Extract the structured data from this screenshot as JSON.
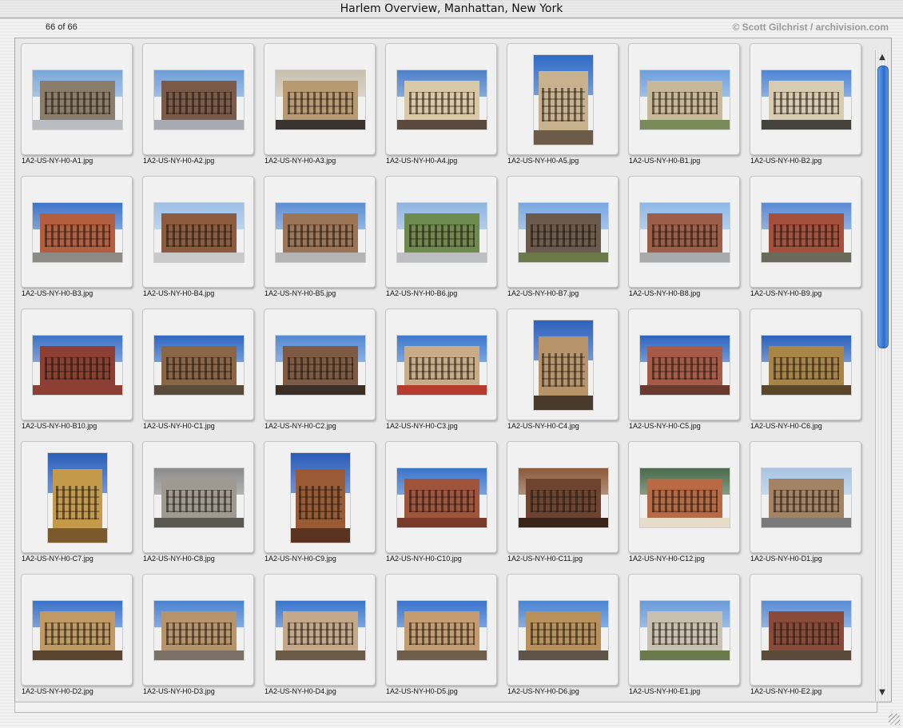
{
  "window": {
    "title": "Harlem Overview, Manhattan, New York"
  },
  "status": {
    "counter": "66 of 66",
    "copyright": "© Scott Gilchrist / archivision.com"
  },
  "thumbnails": [
    {
      "name": "1A2-US-NY-H0-A1.jpg",
      "orient": "land",
      "sky": "#7aa6d9",
      "bldg": "#8a7d6c",
      "ground": "#b9bcc0"
    },
    {
      "name": "1A2-US-NY-H0-A2.jpg",
      "orient": "land",
      "sky": "#6e9ed6",
      "bldg": "#7b5a4a",
      "ground": "#a7abb1"
    },
    {
      "name": "1A2-US-NY-H0-A3.jpg",
      "orient": "land",
      "sky": "#c8c0ae",
      "bldg": "#b89a72",
      "ground": "#3a3330"
    },
    {
      "name": "1A2-US-NY-H0-A4.jpg",
      "orient": "land",
      "sky": "#4d7fc7",
      "bldg": "#d9c9a6",
      "ground": "#5a4a3e"
    },
    {
      "name": "1A2-US-NY-H0-A5.jpg",
      "orient": "port",
      "sky": "#2f6bc6",
      "bldg": "#c8b18d",
      "ground": "#6c5b48"
    },
    {
      "name": "1A2-US-NY-H0-B1.jpg",
      "orient": "land",
      "sky": "#6d9fdc",
      "bldg": "#c8b89a",
      "ground": "#7a8a58"
    },
    {
      "name": "1A2-US-NY-H0-B2.jpg",
      "orient": "land",
      "sky": "#4f86d4",
      "bldg": "#d7cbb1",
      "ground": "#46423c"
    },
    {
      "name": "1A2-US-NY-H0-B3.jpg",
      "orient": "land",
      "sky": "#3f74c8",
      "bldg": "#b35e3e",
      "ground": "#8d8a86"
    },
    {
      "name": "1A2-US-NY-H0-B4.jpg",
      "orient": "land",
      "sky": "#9cc0e6",
      "bldg": "#8c5a3e",
      "ground": "#c9c9c9"
    },
    {
      "name": "1A2-US-NY-H0-B5.jpg",
      "orient": "land",
      "sky": "#5d8fd4",
      "bldg": "#9c7456",
      "ground": "#b4b4b4"
    },
    {
      "name": "1A2-US-NY-H0-B6.jpg",
      "orient": "land",
      "sky": "#8eb5e0",
      "bldg": "#6f8a4e",
      "ground": "#bdbfc3"
    },
    {
      "name": "1A2-US-NY-H0-B7.jpg",
      "orient": "land",
      "sky": "#78a7e0",
      "bldg": "#6b5a4e",
      "ground": "#6a7a4a"
    },
    {
      "name": "1A2-US-NY-H0-B8.jpg",
      "orient": "land",
      "sky": "#8db8e6",
      "bldg": "#9c5e48",
      "ground": "#a8aaac"
    },
    {
      "name": "1A2-US-NY-H0-B9.jpg",
      "orient": "land",
      "sky": "#5a8ad2",
      "bldg": "#a4503c",
      "ground": "#6a6a5a"
    },
    {
      "name": "1A2-US-NY-H0-B10.jpg",
      "orient": "land",
      "sky": "#3e73c6",
      "bldg": "#8e3f34",
      "ground": "#8e3f34"
    },
    {
      "name": "1A2-US-NY-H0-C1.jpg",
      "orient": "land",
      "sky": "#2f68c2",
      "bldg": "#8a6546",
      "ground": "#5a4a3a"
    },
    {
      "name": "1A2-US-NY-H0-C2.jpg",
      "orient": "land",
      "sky": "#5488d2",
      "bldg": "#7e5a44",
      "ground": "#3a2e26"
    },
    {
      "name": "1A2-US-NY-H0-C3.jpg",
      "orient": "land",
      "sky": "#3c78cc",
      "bldg": "#c8ac88",
      "ground": "#b63a2e"
    },
    {
      "name": "1A2-US-NY-H0-C4.jpg",
      "orient": "port",
      "sky": "#2e62bc",
      "bldg": "#b8946a",
      "ground": "#4a3a2c"
    },
    {
      "name": "1A2-US-NY-H0-C5.jpg",
      "orient": "land",
      "sky": "#2d66c0",
      "bldg": "#a85a48",
      "ground": "#6a3a2e"
    },
    {
      "name": "1A2-US-NY-H0-C6.jpg",
      "orient": "land",
      "sky": "#2b62bc",
      "bldg": "#a88446",
      "ground": "#5a4628"
    },
    {
      "name": "1A2-US-NY-H0-C7.jpg",
      "orient": "port",
      "sky": "#2a5fba",
      "bldg": "#c49a4a",
      "ground": "#7a5a2c"
    },
    {
      "name": "1A2-US-NY-H0-C8.jpg",
      "orient": "land",
      "sky": "#8c8c8c",
      "bldg": "#9e9a92",
      "ground": "#5a5650"
    },
    {
      "name": "1A2-US-NY-H0-C9.jpg",
      "orient": "port",
      "sky": "#2a5cb8",
      "bldg": "#9a5a34",
      "ground": "#5a3420"
    },
    {
      "name": "1A2-US-NY-H0-C10.jpg",
      "orient": "land",
      "sky": "#3a74ca",
      "bldg": "#a0543c",
      "ground": "#7a3a2a"
    },
    {
      "name": "1A2-US-NY-H0-C11.jpg",
      "orient": "land",
      "sky": "#8a5a3a",
      "bldg": "#6e4430",
      "ground": "#3a2418"
    },
    {
      "name": "1A2-US-NY-H0-C12.jpg",
      "orient": "land",
      "sky": "#4a6a4a",
      "bldg": "#b86a44",
      "ground": "#e6dcc8"
    },
    {
      "name": "1A2-US-NY-H0-D1.jpg",
      "orient": "land",
      "sky": "#a8c4e4",
      "bldg": "#a48264",
      "ground": "#7a7a7a"
    },
    {
      "name": "1A2-US-NY-H0-D2.jpg",
      "orient": "land",
      "sky": "#3a72c8",
      "bldg": "#c09a62",
      "ground": "#5a4630"
    },
    {
      "name": "1A2-US-NY-H0-D3.jpg",
      "orient": "land",
      "sky": "#4a82d0",
      "bldg": "#b8946c",
      "ground": "#7a7066"
    },
    {
      "name": "1A2-US-NY-H0-D4.jpg",
      "orient": "land",
      "sky": "#3c76cc",
      "bldg": "#c4a88a",
      "ground": "#6a5a48"
    },
    {
      "name": "1A2-US-NY-H0-D5.jpg",
      "orient": "land",
      "sky": "#3a74cc",
      "bldg": "#c49c70",
      "ground": "#6e5e4c"
    },
    {
      "name": "1A2-US-NY-H0-D6.jpg",
      "orient": "land",
      "sky": "#4a84d2",
      "bldg": "#b8905a",
      "ground": "#5e5448"
    },
    {
      "name": "1A2-US-NY-H0-E1.jpg",
      "orient": "land",
      "sky": "#6a9ad8",
      "bldg": "#c8c0b0",
      "ground": "#6a7a4a"
    },
    {
      "name": "1A2-US-NY-H0-E2.jpg",
      "orient": "land",
      "sky": "#5a8cd4",
      "bldg": "#8a4a3a",
      "ground": "#5a4a3a"
    }
  ]
}
